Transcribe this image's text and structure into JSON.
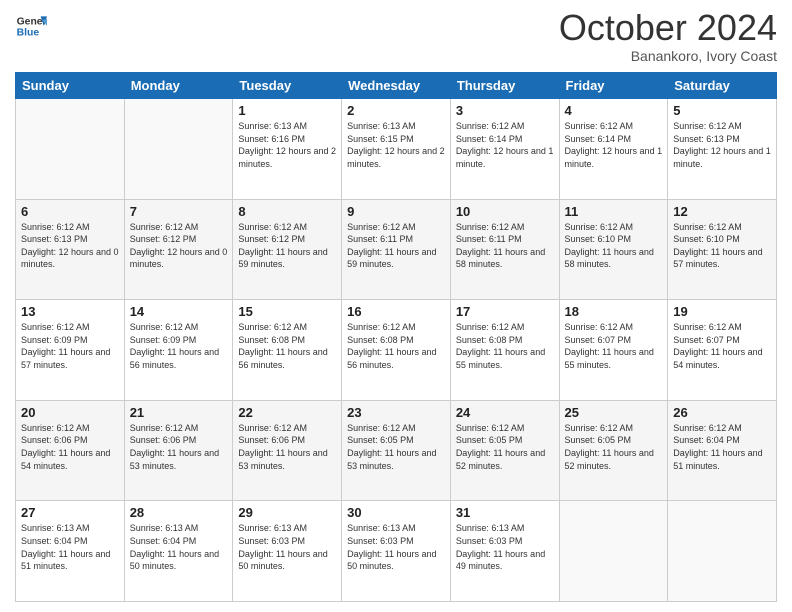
{
  "header": {
    "logo_line1": "General",
    "logo_line2": "Blue",
    "month": "October 2024",
    "location": "Banankoro, Ivory Coast"
  },
  "days_of_week": [
    "Sunday",
    "Monday",
    "Tuesday",
    "Wednesday",
    "Thursday",
    "Friday",
    "Saturday"
  ],
  "weeks": [
    [
      {
        "day": "",
        "info": ""
      },
      {
        "day": "",
        "info": ""
      },
      {
        "day": "1",
        "info": "Sunrise: 6:13 AM\nSunset: 6:16 PM\nDaylight: 12 hours and 2 minutes."
      },
      {
        "day": "2",
        "info": "Sunrise: 6:13 AM\nSunset: 6:15 PM\nDaylight: 12 hours and 2 minutes."
      },
      {
        "day": "3",
        "info": "Sunrise: 6:12 AM\nSunset: 6:14 PM\nDaylight: 12 hours and 1 minute."
      },
      {
        "day": "4",
        "info": "Sunrise: 6:12 AM\nSunset: 6:14 PM\nDaylight: 12 hours and 1 minute."
      },
      {
        "day": "5",
        "info": "Sunrise: 6:12 AM\nSunset: 6:13 PM\nDaylight: 12 hours and 1 minute."
      }
    ],
    [
      {
        "day": "6",
        "info": "Sunrise: 6:12 AM\nSunset: 6:13 PM\nDaylight: 12 hours and 0 minutes."
      },
      {
        "day": "7",
        "info": "Sunrise: 6:12 AM\nSunset: 6:12 PM\nDaylight: 12 hours and 0 minutes."
      },
      {
        "day": "8",
        "info": "Sunrise: 6:12 AM\nSunset: 6:12 PM\nDaylight: 11 hours and 59 minutes."
      },
      {
        "day": "9",
        "info": "Sunrise: 6:12 AM\nSunset: 6:11 PM\nDaylight: 11 hours and 59 minutes."
      },
      {
        "day": "10",
        "info": "Sunrise: 6:12 AM\nSunset: 6:11 PM\nDaylight: 11 hours and 58 minutes."
      },
      {
        "day": "11",
        "info": "Sunrise: 6:12 AM\nSunset: 6:10 PM\nDaylight: 11 hours and 58 minutes."
      },
      {
        "day": "12",
        "info": "Sunrise: 6:12 AM\nSunset: 6:10 PM\nDaylight: 11 hours and 57 minutes."
      }
    ],
    [
      {
        "day": "13",
        "info": "Sunrise: 6:12 AM\nSunset: 6:09 PM\nDaylight: 11 hours and 57 minutes."
      },
      {
        "day": "14",
        "info": "Sunrise: 6:12 AM\nSunset: 6:09 PM\nDaylight: 11 hours and 56 minutes."
      },
      {
        "day": "15",
        "info": "Sunrise: 6:12 AM\nSunset: 6:08 PM\nDaylight: 11 hours and 56 minutes."
      },
      {
        "day": "16",
        "info": "Sunrise: 6:12 AM\nSunset: 6:08 PM\nDaylight: 11 hours and 56 minutes."
      },
      {
        "day": "17",
        "info": "Sunrise: 6:12 AM\nSunset: 6:08 PM\nDaylight: 11 hours and 55 minutes."
      },
      {
        "day": "18",
        "info": "Sunrise: 6:12 AM\nSunset: 6:07 PM\nDaylight: 11 hours and 55 minutes."
      },
      {
        "day": "19",
        "info": "Sunrise: 6:12 AM\nSunset: 6:07 PM\nDaylight: 11 hours and 54 minutes."
      }
    ],
    [
      {
        "day": "20",
        "info": "Sunrise: 6:12 AM\nSunset: 6:06 PM\nDaylight: 11 hours and 54 minutes."
      },
      {
        "day": "21",
        "info": "Sunrise: 6:12 AM\nSunset: 6:06 PM\nDaylight: 11 hours and 53 minutes."
      },
      {
        "day": "22",
        "info": "Sunrise: 6:12 AM\nSunset: 6:06 PM\nDaylight: 11 hours and 53 minutes."
      },
      {
        "day": "23",
        "info": "Sunrise: 6:12 AM\nSunset: 6:05 PM\nDaylight: 11 hours and 53 minutes."
      },
      {
        "day": "24",
        "info": "Sunrise: 6:12 AM\nSunset: 6:05 PM\nDaylight: 11 hours and 52 minutes."
      },
      {
        "day": "25",
        "info": "Sunrise: 6:12 AM\nSunset: 6:05 PM\nDaylight: 11 hours and 52 minutes."
      },
      {
        "day": "26",
        "info": "Sunrise: 6:12 AM\nSunset: 6:04 PM\nDaylight: 11 hours and 51 minutes."
      }
    ],
    [
      {
        "day": "27",
        "info": "Sunrise: 6:13 AM\nSunset: 6:04 PM\nDaylight: 11 hours and 51 minutes."
      },
      {
        "day": "28",
        "info": "Sunrise: 6:13 AM\nSunset: 6:04 PM\nDaylight: 11 hours and 50 minutes."
      },
      {
        "day": "29",
        "info": "Sunrise: 6:13 AM\nSunset: 6:03 PM\nDaylight: 11 hours and 50 minutes."
      },
      {
        "day": "30",
        "info": "Sunrise: 6:13 AM\nSunset: 6:03 PM\nDaylight: 11 hours and 50 minutes."
      },
      {
        "day": "31",
        "info": "Sunrise: 6:13 AM\nSunset: 6:03 PM\nDaylight: 11 hours and 49 minutes."
      },
      {
        "day": "",
        "info": ""
      },
      {
        "day": "",
        "info": ""
      }
    ]
  ]
}
